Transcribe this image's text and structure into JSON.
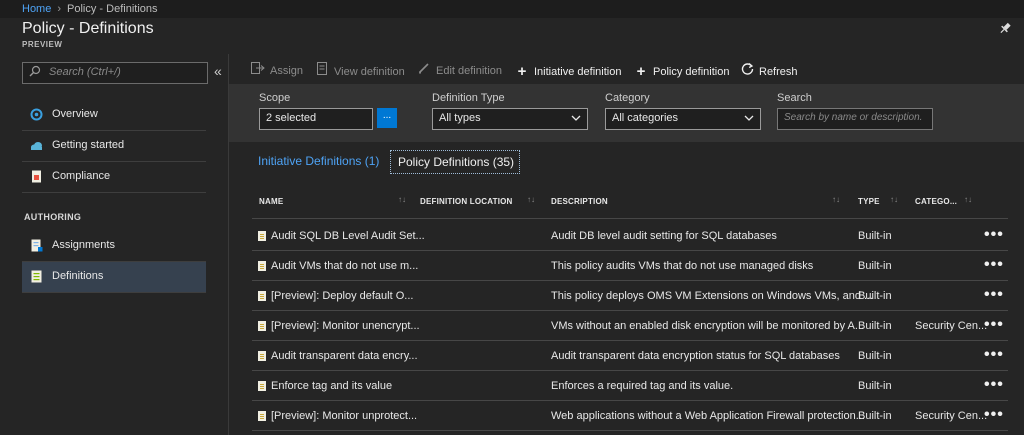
{
  "breadcrumb": {
    "home": "Home",
    "separator": "›",
    "current": "Policy - Definitions"
  },
  "page": {
    "title": "Policy - Definitions",
    "subtitle": "PREVIEW",
    "pin_icon": "pin-icon"
  },
  "sidebar": {
    "search_placeholder": "Search (Ctrl+/)",
    "collapse_glyph": "«",
    "items": [
      {
        "label": "Overview",
        "icon": "overview-icon",
        "color": "#3aa0e0"
      },
      {
        "label": "Getting started",
        "icon": "cloud-icon",
        "color": "#59b4d9"
      },
      {
        "label": "Compliance",
        "icon": "compliance-icon",
        "color": "#e8523f"
      }
    ],
    "section_authoring": "AUTHORING",
    "authoring_items": [
      {
        "label": "Assignments",
        "icon": "assignments-icon",
        "color": "#7fb2e5"
      },
      {
        "label": "Definitions",
        "icon": "definitions-icon",
        "color": "#7fba00"
      }
    ]
  },
  "toolbar": {
    "assign": "Assign",
    "view_definition": "View definition",
    "edit_definition": "Edit definition",
    "initiative_definition": "Initiative definition",
    "policy_definition": "Policy definition",
    "refresh": "Refresh"
  },
  "filters": {
    "scope_label": "Scope",
    "scope_value": "2 selected",
    "scope_button": "...",
    "type_label": "Definition Type",
    "type_value": "All types",
    "category_label": "Category",
    "category_value": "All categories",
    "search_label": "Search",
    "search_placeholder": "Search by name or description."
  },
  "tabs": {
    "initiative": "Initiative Definitions (1)",
    "policy": "Policy Definitions (35)"
  },
  "table": {
    "headers": {
      "name": "NAME",
      "location": "DEFINITION LOCATION",
      "description": "DESCRIPTION",
      "type": "TYPE",
      "category": "CATEGO..."
    },
    "rows": [
      {
        "name": "Audit SQL DB Level Audit Set...",
        "location": "",
        "description": "Audit DB level audit setting for SQL databases",
        "type": "Built-in",
        "category": ""
      },
      {
        "name": "Audit VMs that do not use m...",
        "location": "",
        "description": "This policy audits VMs that do not use managed disks",
        "type": "Built-in",
        "category": ""
      },
      {
        "name": "[Preview]: Deploy default O...",
        "location": "",
        "description": "This policy deploys OMS VM Extensions on Windows VMs, and ...",
        "type": "Built-in",
        "category": ""
      },
      {
        "name": "[Preview]: Monitor unencrypt...",
        "location": "",
        "description": "VMs without an enabled disk encryption will be monitored by A...",
        "type": "Built-in",
        "category": "Security Cen..."
      },
      {
        "name": "Audit transparent data encry...",
        "location": "",
        "description": "Audit transparent data encryption status for SQL databases",
        "type": "Built-in",
        "category": ""
      },
      {
        "name": "Enforce tag and its value",
        "location": "",
        "description": "Enforces a required tag and its value.",
        "type": "Built-in",
        "category": ""
      },
      {
        "name": "[Preview]: Monitor unprotect...",
        "location": "",
        "description": "Web applications without a Web Application Firewall protection...",
        "type": "Built-in",
        "category": "Security Cen..."
      }
    ]
  }
}
